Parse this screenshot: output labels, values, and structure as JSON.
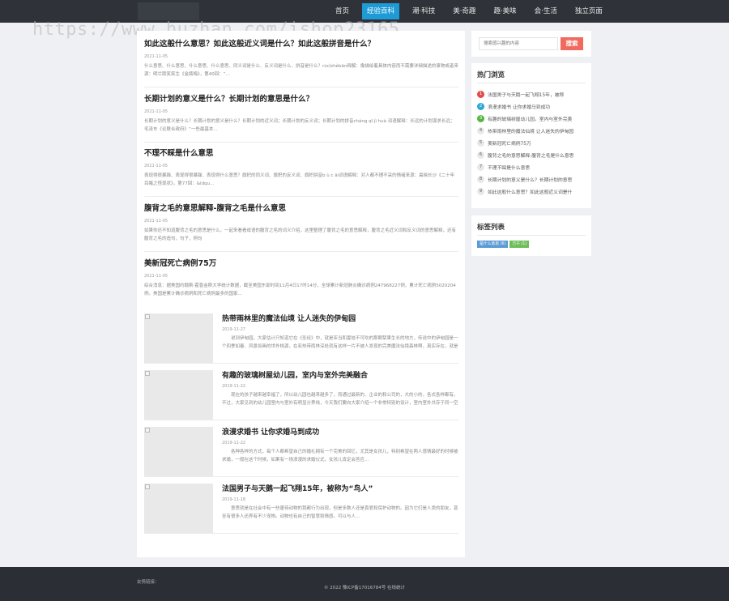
{
  "nav": {
    "items": [
      "首页",
      "经验百科",
      "潮·科技",
      "美·奇趣",
      "趣·美味",
      "会·生活",
      "独立页面"
    ],
    "active_index": 1
  },
  "watermark": "https://www.huzhan.com/ishop23165",
  "posts": [
    {
      "title": "如此这般什么意思？如此这般近义词是什么？如此这般拼音是什么？",
      "date": "2021-11-05",
      "excerpt": "什么意思、什么意思、什么意思、什么意思、同义词是什么、反义词是什么、拼音是什么？rúcǐzhèbān释解：像描绘着具体内容而不需要详细描述的事物或者来源：明兰陵笑笑生《金瓶梅》，第40回：“..."
    },
    {
      "title": "长期计划的意义是什么？长期计划的意思是什么？",
      "date": "2021-11-05",
      "excerpt": "长期计划的意义是什么？长期计划的意义是什么？长期计划的近义词；长期计划的反义词；长期计划的拼音cháng qī jì huà 词语解释：长远的计划谋求长远；毛泽东《论联合政府》“一些最基本..."
    },
    {
      "title": "不理不睬是什么意思",
      "date": "2021-11-05",
      "excerpt": "表现得很暴躁、表现得很暴躁、表现得什么意思？旗帜的同义词、旗帜的反义词、旗帜拼音b ù c ǎi词语解释：对人都不理不采的情绪来源：晨晓长沙《二十年目睹之怪现状》，第77回：&ldqu..."
    },
    {
      "title": "腹背之毛的意思解释-腹背之毛是什么意思",
      "date": "2021-11-05",
      "excerpt": "如果你还不知道腹背之毛的意思是什么，一起来看看成语的腹背之毛的词义介绍，这里整理了腹背之毛的意思解释，腹背之毛近义词和反义词的意思解释，还有腹背之毛的造句，句子，例句"
    },
    {
      "title": "美新冠死亡病例75万",
      "date": "2021-11-05",
      "excerpt": "综合消息：据美国约翰斯·霍普金斯大学统计数据，截至美国东部时间11月4日17时14分，全球累计新冠肺炎确诊病例247968227例，累计死亡病例5020204例。美国是累计确诊病例和死亡病例最多的国家..."
    }
  ],
  "thumb_posts": [
    {
      "title": "热带雨林里的魔法仙境 让人迷失的伊甸园",
      "date": "2019-11-27",
      "excerpt": "说到伊甸园，大家估计只知道它在《圣经》中，就是亚当和夏娃不可吃的那颗禁果生长的地方，传说中的伊甸园是一个四季如春、风景如画的世外桃源，在亚热带雨林深处就有这样一片不被人发现的完美魔法仙境森林啊，真实存在，就是我们这一片丛林"
    },
    {
      "title": "有趣的玻璃树屋幼儿园，室内与室外完美融合",
      "date": "2019-11-22",
      "excerpt": "现在的孩子越来越幸福了，所以幼儿园也越来越多了，而通过最新的、企业的和公司的，大的小的，各式各样都有。不过，大家见到的幼儿园室内与室外有明显分界线，今天我们要向大家介绍一个非常特别的设计，室内室外共存于同一空间中"
    },
    {
      "title": "浪漫求婚书 让你求婚马到成功",
      "date": "2019-11-22",
      "excerpt": "各种各样的方式，每个人都希望自己的婚礼拥有一个完美的回忆，尤其是女孩儿，特别希望在两人感情最好的时候被求婚，一般在这个时候，如果有一场浪漫的求婚仪式，女孩儿肯定会答应..."
    },
    {
      "title": "法国男子与天鹅一起飞翔15年，被称为“鸟人”",
      "date": "2019-11-18",
      "excerpt": "意思就是在社会中有一些善待动物的我都行为出现，但是多数人还是喜爱和保护动物的。因为它们是人类的朋友，甚至有很多人还养有不少宠物。动物也有自己的智慧和情感，可以与人..."
    }
  ],
  "search": {
    "placeholder": "搜索感兴趣的内容",
    "button": "搜索"
  },
  "hot": {
    "title": "热门浏览",
    "items": [
      "法国男子与天鹅一起飞翔15年，被称",
      "浪漫求婚书 让你求婚马到成功",
      "有趣的玻璃树屋幼儿园，室内与室外完美",
      "热带雨林里的魔法仙境 让人迷失的伊甸园",
      "美新冠死亡病例75万",
      "腹背之毛的意思解释-腹背之毛是什么意思",
      "不理不睬是什么意思",
      "长期计划的意义是什么？长期计划的意思",
      "如此这般什么意思？如此这般近义词是什"
    ]
  },
  "tags": {
    "title": "标签列表",
    "items": [
      {
        "label": "是什么意思 (6)",
        "color": "#5b9bd5"
      },
      {
        "label": "万千 (1)",
        "color": "#6dbe5a"
      }
    ]
  },
  "footer": {
    "links_label": "友情链接：",
    "copyright": "© 2022  豫ICP备17016784号  在线统计"
  }
}
